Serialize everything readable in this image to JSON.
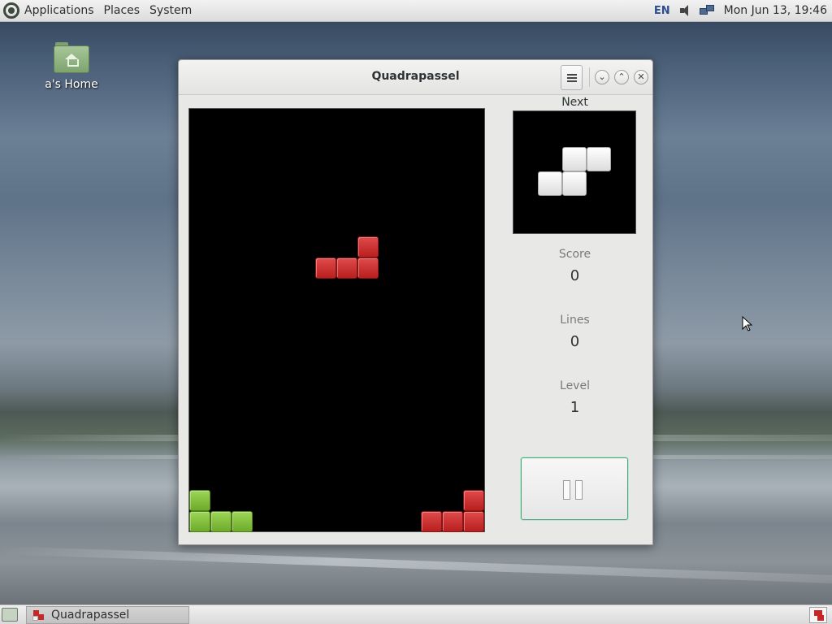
{
  "top_panel": {
    "menus": [
      "Applications",
      "Places",
      "System"
    ],
    "keyboard_layout": "EN",
    "clock": "Mon Jun 13, 19:46"
  },
  "desktop": {
    "icons": [
      {
        "label": "a's Home",
        "icon": "home-folder-icon"
      }
    ]
  },
  "window": {
    "title": "Quadrapassel",
    "controls": [
      "menu-icon",
      "minimize-icon",
      "maximize-icon",
      "close-icon"
    ]
  },
  "game": {
    "next_label": "Next",
    "score_label": "Score",
    "score": "0",
    "lines_label": "Lines",
    "lines": "0",
    "level_label": "Level",
    "level": "1",
    "pause_button": "pause-icon",
    "block_colors": {
      "red": "#c62828",
      "green": "#7cbf3a",
      "white": "#f4f4f4"
    }
  },
  "taskbar": {
    "tasks": [
      {
        "label": "Quadrapassel",
        "icon": "quadrapassel-icon"
      }
    ]
  }
}
